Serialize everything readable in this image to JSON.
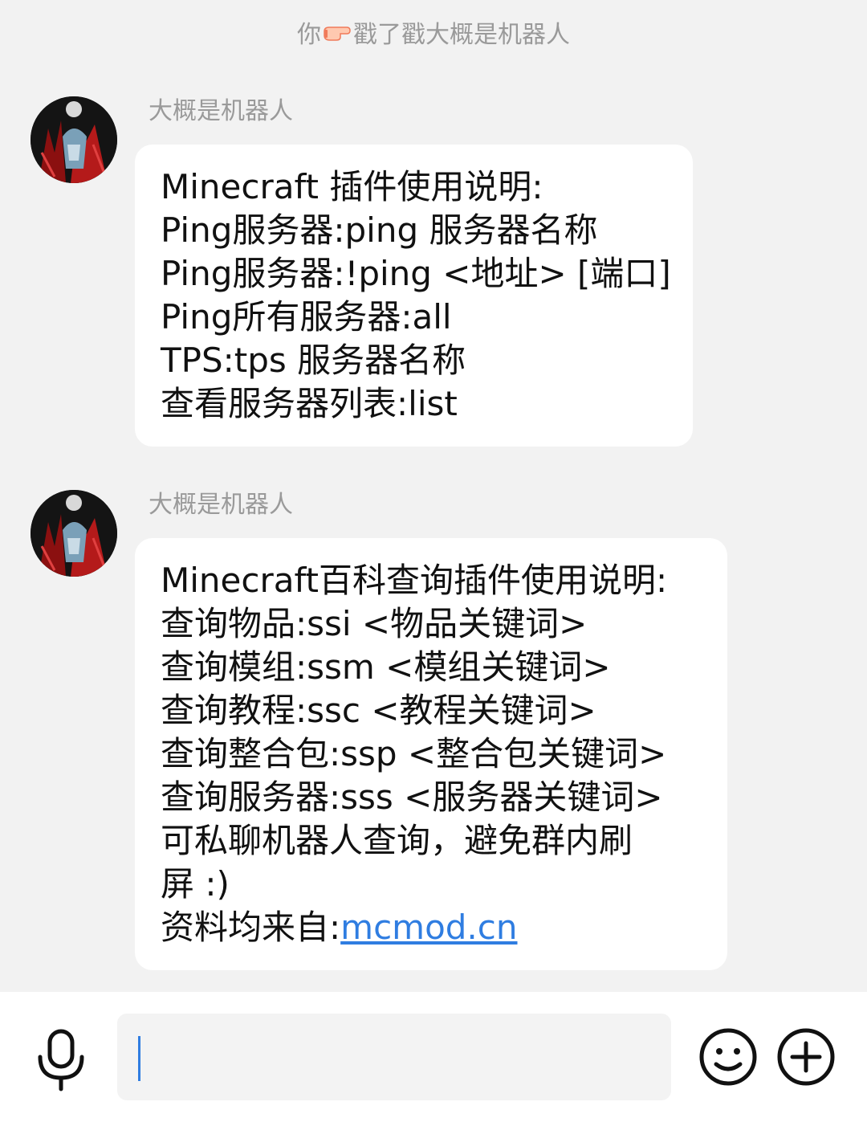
{
  "system_notice": {
    "prefix": "你",
    "icon": "pointing-hand-emoji",
    "suffix": "戳了戳大概是机器人"
  },
  "messages": [
    {
      "sender": "大概是机器人",
      "lines": [
        "Minecraft 插件使用说明:",
        "Ping服务器:ping 服务器名称",
        "Ping服务器:!ping <地址> [端口]",
        "Ping所有服务器:all",
        "TPS:tps 服务器名称",
        "查看服务器列表:list"
      ]
    },
    {
      "sender": "大概是机器人",
      "lines": [
        "Minecraft百科查询插件使用说明:",
        "查询物品:ssi <物品关键词>",
        "查询模组:ssm <模组关键词>",
        "查询教程:ssc <教程关键词>",
        "查询整合包:ssp <整合包关键词>",
        "查询服务器:sss <服务器关键词>",
        "可私聊机器人查询，避免群内刷",
        "屏 :)"
      ],
      "source_label": "资料均来自:",
      "source_link": "mcmod.cn"
    }
  ],
  "input_bar": {
    "input_value": "",
    "mic_icon": "microphone-icon",
    "emoji_icon": "smiley-face-icon",
    "plus_icon": "plus-circle-icon"
  },
  "colors": {
    "background": "#f2f2f2",
    "bubble": "#ffffff",
    "link": "#2f7de1",
    "muted_text": "#9a9a9a"
  }
}
